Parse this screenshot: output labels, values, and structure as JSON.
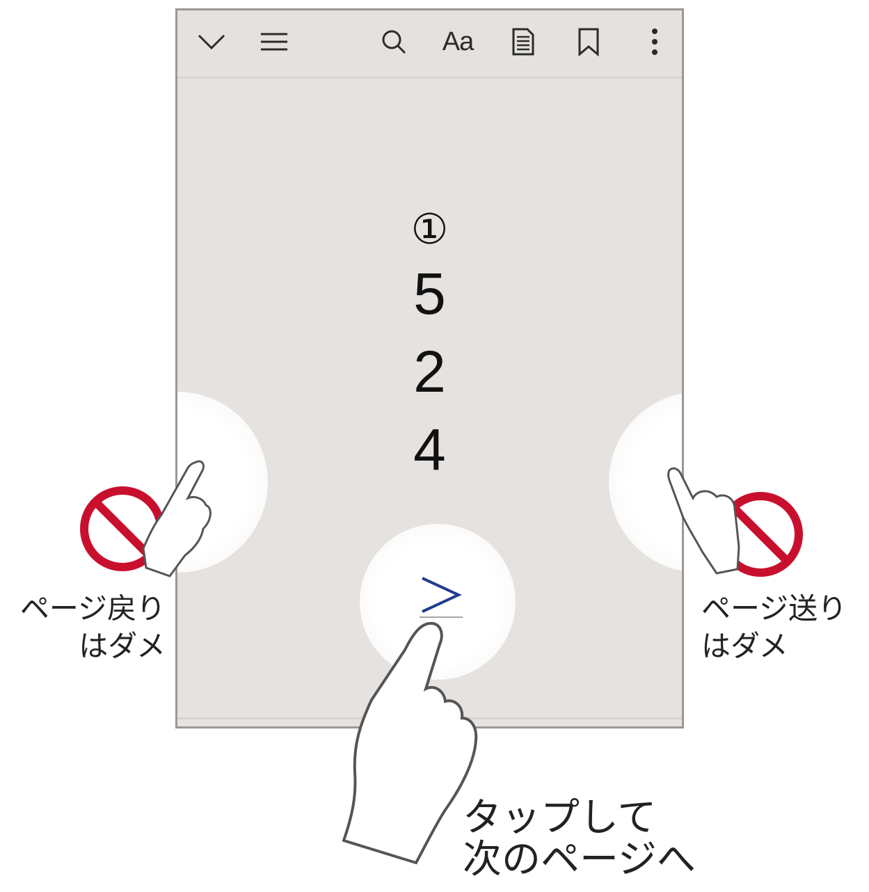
{
  "toolbar": {
    "buttons": [
      {
        "name": "chevron-down-icon"
      },
      {
        "name": "menu-icon"
      },
      {
        "name": "search-icon"
      },
      {
        "name": "font-size-button",
        "label": "Aa"
      },
      {
        "name": "document-icon"
      },
      {
        "name": "bookmark-icon"
      },
      {
        "name": "more-vertical-icon"
      }
    ]
  },
  "page": {
    "circled_number": "①",
    "digits": [
      "5",
      "2",
      "4"
    ]
  },
  "next_button": {
    "icon": "chevron-right-icon",
    "color": "#1f3d8f"
  },
  "annotations": {
    "back_line1": "ページ戻り",
    "back_line2": "はダメ",
    "forward_line1": "ページ送り",
    "forward_line2": "はダメ",
    "tap_line1": "タップして",
    "tap_line2": "次のページへ"
  },
  "colors": {
    "prohibit_red": "#c8102e",
    "screen_bg": "#e5e2df",
    "link_blue": "#1f3d8f"
  }
}
